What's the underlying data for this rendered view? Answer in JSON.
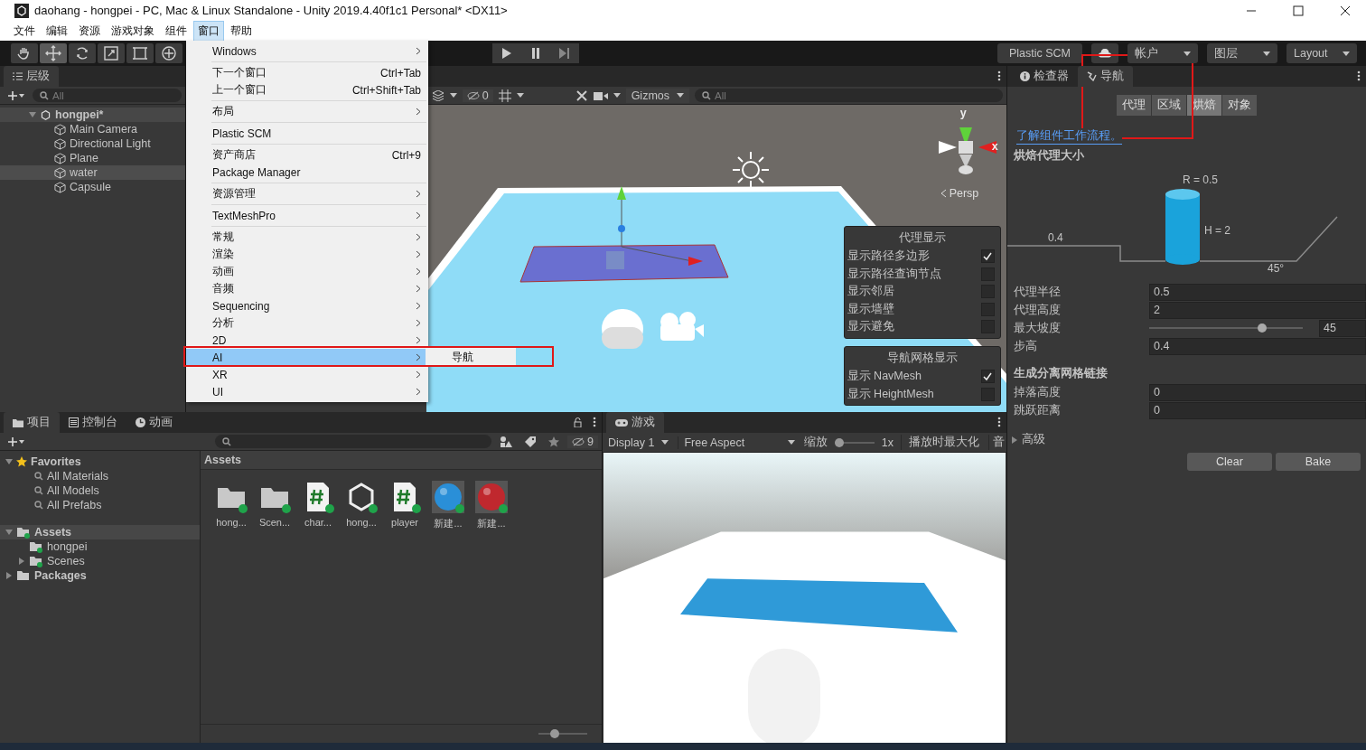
{
  "window": {
    "title": "daohang - hongpei - PC, Mac & Linux Standalone - Unity 2019.4.40f1c1 Personal* <DX11>"
  },
  "menu_bar": [
    {
      "label": "文件",
      "selected": false
    },
    {
      "label": "编辑",
      "selected": false
    },
    {
      "label": "资源",
      "selected": false
    },
    {
      "label": "游戏对象",
      "selected": false
    },
    {
      "label": "组件",
      "selected": false
    },
    {
      "label": "窗口",
      "selected": true
    },
    {
      "label": "帮助",
      "selected": false
    }
  ],
  "open_menu": {
    "groups": [
      [
        {
          "label": "Windows",
          "has_submenu": true,
          "selected": false
        }
      ],
      [
        {
          "label": "下一个窗口",
          "shortcut": "Ctrl+Tab",
          "has_submenu": false,
          "selected": false
        },
        {
          "label": "上一个窗口",
          "shortcut": "Ctrl+Shift+Tab",
          "has_submenu": false,
          "selected": false
        }
      ],
      [
        {
          "label": "布局",
          "has_submenu": true,
          "selected": false
        }
      ],
      [
        {
          "label": "Plastic SCM",
          "has_submenu": false,
          "selected": false
        }
      ],
      [
        {
          "label": "资产商店",
          "shortcut": "Ctrl+9",
          "has_submenu": false,
          "selected": false
        },
        {
          "label": "Package Manager",
          "has_submenu": false,
          "selected": false
        }
      ],
      [
        {
          "label": "资源管理",
          "has_submenu": true,
          "selected": false
        }
      ],
      [
        {
          "label": "TextMeshPro",
          "has_submenu": true,
          "selected": false
        }
      ],
      [
        {
          "label": "常规",
          "has_submenu": true,
          "selected": false
        },
        {
          "label": "渲染",
          "has_submenu": true,
          "selected": false
        },
        {
          "label": "动画",
          "has_submenu": true,
          "selected": false
        },
        {
          "label": "音频",
          "has_submenu": true,
          "selected": false
        },
        {
          "label": "Sequencing",
          "has_submenu": true,
          "selected": false
        },
        {
          "label": "分析",
          "has_submenu": true,
          "selected": false
        },
        {
          "label": "2D",
          "has_submenu": true,
          "selected": false
        },
        {
          "label": "AI",
          "has_submenu": true,
          "selected": true
        },
        {
          "label": "XR",
          "has_submenu": true,
          "selected": false
        },
        {
          "label": "UI",
          "has_submenu": true,
          "selected": false
        }
      ]
    ],
    "submenu": {
      "items": [
        {
          "label": "导航"
        }
      ]
    }
  },
  "toolbar": {
    "tools": [
      {
        "kind": "hand",
        "selected": false
      },
      {
        "kind": "move",
        "selected": true
      },
      {
        "kind": "rotate",
        "selected": false
      },
      {
        "kind": "scale",
        "selected": false
      },
      {
        "kind": "rect",
        "selected": false
      },
      {
        "kind": "transform",
        "selected": false
      }
    ],
    "plastic_scm": "Plastic SCM",
    "account": "帐户",
    "layers": "图层",
    "layout": "Layout"
  },
  "hierarchy": {
    "tab": "层级",
    "search_placeholder": "All",
    "scene": {
      "label": "hongpei*",
      "expanded": true,
      "children": [
        {
          "label": "Main Camera",
          "selected": false
        },
        {
          "label": "Directional Light",
          "selected": false
        },
        {
          "label": "Plane",
          "selected": false
        },
        {
          "label": "water",
          "selected": true
        },
        {
          "label": "Capsule",
          "selected": false
        }
      ]
    }
  },
  "scene_view": {
    "hidden_count": "0",
    "gizmos": "Gizmos",
    "search_placeholder": "All",
    "axis_y": "y",
    "axis_x": "x",
    "projection": "Persp",
    "agent_display": {
      "title": "代理显示",
      "options": [
        {
          "label": "显示路径多边形",
          "checked": true
        },
        {
          "label": "显示路径查询节点",
          "checked": false
        },
        {
          "label": "显示邻居",
          "checked": false
        },
        {
          "label": "显示墙壁",
          "checked": false
        },
        {
          "label": "显示避免",
          "checked": false
        }
      ]
    },
    "navmesh_display": {
      "title": "导航网格显示",
      "options": [
        {
          "label": "显示 NavMesh",
          "checked": true
        },
        {
          "label": "显示 HeightMesh",
          "checked": false
        }
      ]
    }
  },
  "project": {
    "tabs": [
      {
        "kind": "folder",
        "label": "项目",
        "selected": true
      },
      {
        "kind": "console",
        "label": "控制台",
        "selected": false
      },
      {
        "kind": "animation",
        "label": "动画",
        "selected": false
      }
    ],
    "hidden_count": "9",
    "favorites": {
      "label": "Favorites",
      "expanded": true,
      "items": [
        "All Materials",
        "All Models",
        "All Prefabs"
      ]
    },
    "tree": [
      {
        "label": "Assets",
        "expanded": true,
        "selected": true,
        "children": [
          {
            "label": "hongpei",
            "selected": false
          },
          {
            "label": "Scenes",
            "expanded": false,
            "selected": false
          }
        ]
      },
      {
        "label": "Packages",
        "expanded": false,
        "selected": false
      }
    ],
    "breadcrumb": "Assets",
    "assets": [
      {
        "kind": "folder",
        "name": "hong..."
      },
      {
        "kind": "folder",
        "name": "Scen..."
      },
      {
        "kind": "script",
        "name": "char..."
      },
      {
        "kind": "scene",
        "name": "hong..."
      },
      {
        "kind": "script",
        "name": "player"
      },
      {
        "kind": "material",
        "name": "新建...",
        "color": "#2a8fd8"
      },
      {
        "kind": "material",
        "name": "新建...",
        "color": "#c0282e"
      }
    ],
    "icon_size": {
      "level": 0.3
    }
  },
  "game_view": {
    "tab": "游戏",
    "display": "Display 1",
    "aspect": "Free Aspect",
    "scale_label": "缩放",
    "scale": {
      "level": 0
    },
    "scale_value": "1x",
    "maximize": "播放时最大化",
    "audio": "音"
  },
  "inspector": {
    "tabs": [
      {
        "kind": "info",
        "label": "检查器",
        "selected": false
      },
      {
        "kind": "nav",
        "label": "导航",
        "selected": true
      }
    ],
    "nav_tabs": [
      {
        "label": "代理",
        "selected": false
      },
      {
        "label": "区域",
        "selected": false
      },
      {
        "label": "烘焙",
        "selected": true
      },
      {
        "label": "对象",
        "selected": false
      }
    ],
    "link": "了解组件工作流程。",
    "section_title": "烘焙代理大小",
    "diagram": {
      "radius": "R = 0.5",
      "height": "H = 2",
      "step": "0.4",
      "angle": "45°"
    },
    "fields": [
      {
        "kind": "text",
        "label": "代理半径",
        "value": "0.5"
      },
      {
        "kind": "text",
        "label": "代理高度",
        "value": "2"
      },
      {
        "kind": "slider",
        "label": "最大坡度",
        "value": "45",
        "level": 0.75
      },
      {
        "kind": "text",
        "label": "步高",
        "value": "0.4"
      }
    ],
    "links_title": "生成分离网格链接",
    "link_fields": [
      {
        "kind": "text",
        "label": "掉落高度",
        "value": "0"
      },
      {
        "kind": "text",
        "label": "跳跃距离",
        "value": "0"
      }
    ],
    "advanced": {
      "label": "高级",
      "expanded": false
    },
    "buttons": [
      "Clear",
      "Bake"
    ]
  }
}
